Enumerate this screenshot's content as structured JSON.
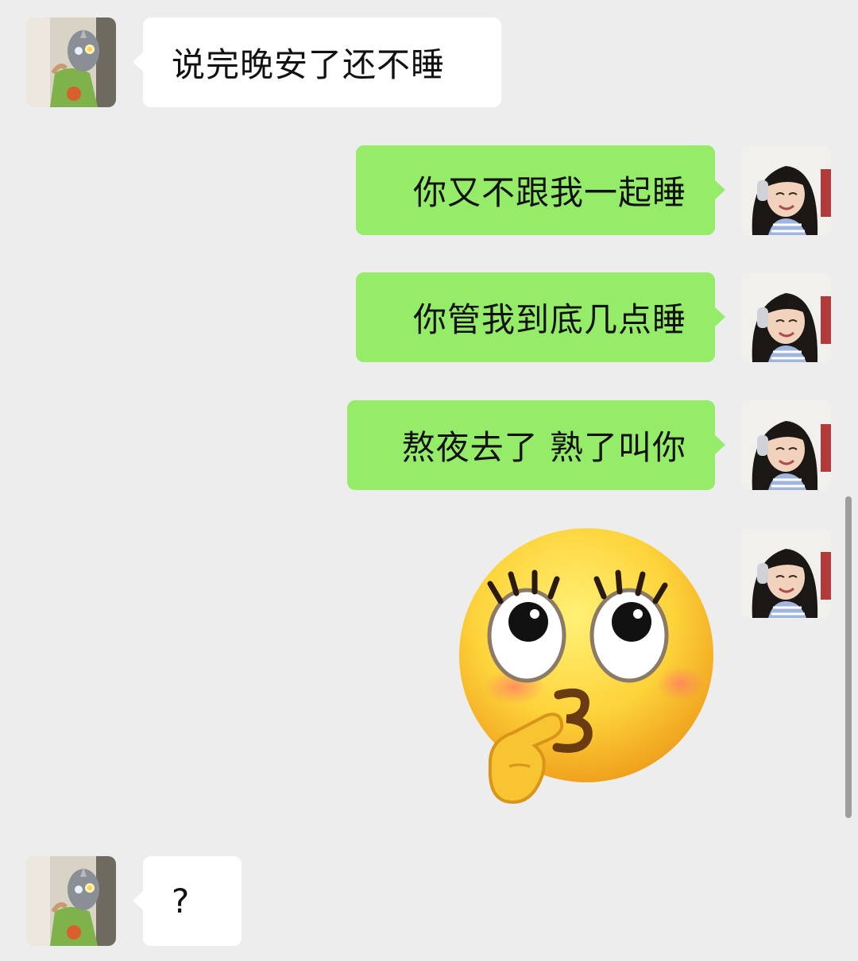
{
  "conversation": {
    "messages": [
      {
        "side": "incoming",
        "text": "说完晚安了还不睡"
      },
      {
        "side": "outgoing",
        "text": "你又不跟我一起睡"
      },
      {
        "side": "outgoing",
        "text": "你管我到底几点睡"
      },
      {
        "side": "outgoing",
        "text": "熬夜去了 熟了叫你"
      },
      {
        "side": "outgoing",
        "sticker": "kissing-emoji-sticker"
      },
      {
        "side": "incoming",
        "text": "?"
      }
    ]
  },
  "colors": {
    "background": "#ededed",
    "incoming_bubble": "#ffffff",
    "outgoing_bubble": "#95ec69",
    "text": "#111111"
  },
  "icons": {
    "incoming_avatar": "ultraman-avatar",
    "outgoing_avatar": "girl-headphones-avatar",
    "sticker": "kissing-emoji-sticker"
  }
}
